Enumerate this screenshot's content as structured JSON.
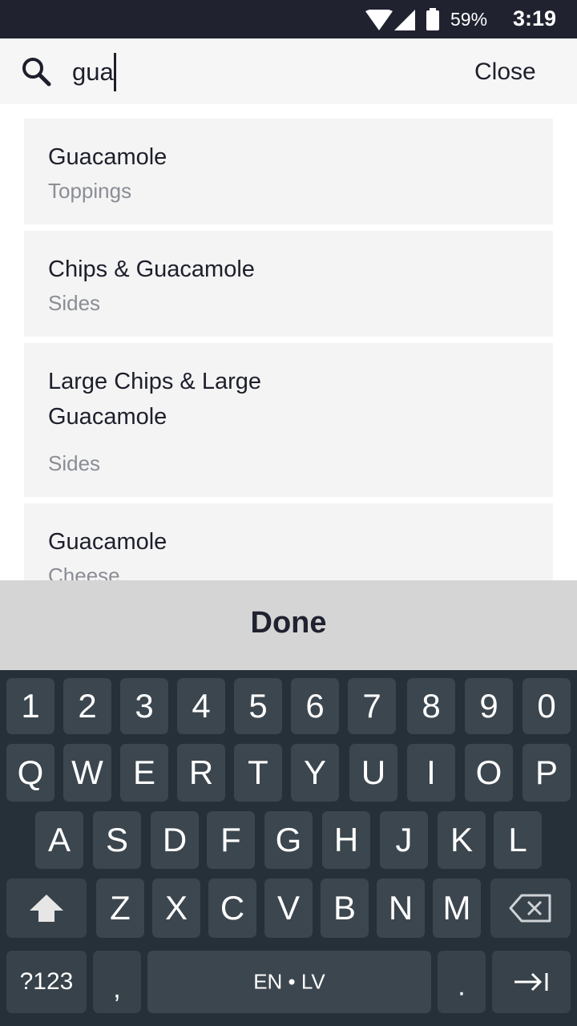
{
  "status_bar": {
    "battery": "59%",
    "time": "3:19"
  },
  "search": {
    "query": "gua",
    "close_label": "Close"
  },
  "results": [
    {
      "title": "Guacamole",
      "category": "Toppings"
    },
    {
      "title_line1": "Chips & Guacamole",
      "category": "Sides"
    },
    {
      "title_line1": "Large Chips & Large",
      "title_line2": "Guacamole",
      "category": "Sides"
    },
    {
      "title": "Guacamole",
      "category": "Cheese"
    }
  ],
  "done_bar": {
    "label": "Done"
  },
  "keyboard": {
    "number_row": [
      "1",
      "2",
      "3",
      "4",
      "5",
      "6",
      "7",
      "8",
      "9",
      "0"
    ],
    "row1": [
      "Q",
      "W",
      "E",
      "R",
      "T",
      "Y",
      "U",
      "I",
      "O",
      "P"
    ],
    "row2": [
      "A",
      "S",
      "D",
      "F",
      "G",
      "H",
      "J",
      "K",
      "L"
    ],
    "row3": [
      "Z",
      "X",
      "C",
      "V",
      "B",
      "N",
      "M"
    ],
    "symbols_label": "?123",
    "comma": ",",
    "space_label": "EN • LV",
    "period": ".",
    "icons": {
      "shift": "shift-icon",
      "backspace": "backspace-icon",
      "next": "next-field-icon"
    }
  }
}
